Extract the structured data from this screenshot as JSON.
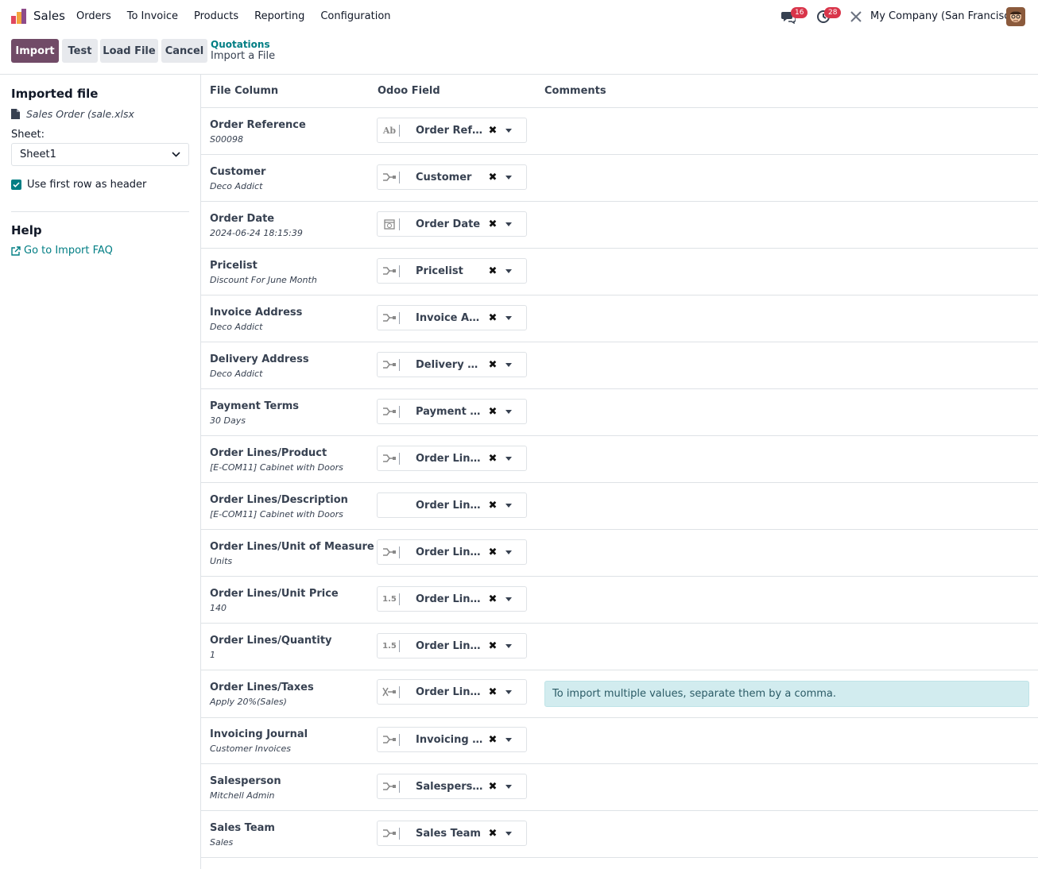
{
  "navbar": {
    "app_name": "Sales",
    "menu": [
      "Orders",
      "To Invoice",
      "Products",
      "Reporting",
      "Configuration"
    ],
    "messages_count": "16",
    "activities_count": "28",
    "company": "My Company (San Francisco)"
  },
  "control_panel": {
    "import_label": "Import",
    "test_label": "Test",
    "load_file_label": "Load File",
    "cancel_label": "Cancel",
    "breadcrumb_parent": "Quotations",
    "breadcrumb_current": "Import a File"
  },
  "sidebar": {
    "imported_file_title": "Imported file",
    "file_name": "Sales Order (sale.xlsx",
    "sheet_label": "Sheet:",
    "sheet_value": "Sheet1",
    "header_checkbox_label": "Use first row as header",
    "header_checkbox_checked": true,
    "help_title": "Help",
    "faq_link": "Go to Import FAQ"
  },
  "table": {
    "headers": {
      "file_column": "File Column",
      "odoo_field": "Odoo Field",
      "comments": "Comments"
    },
    "rows": [
      {
        "column": "Order Reference",
        "sample": "S00098",
        "field": "Order Reference",
        "type_icon": "text-icon",
        "comment": ""
      },
      {
        "column": "Customer",
        "sample": "Deco Addict",
        "field": "Customer",
        "type_icon": "relation-icon",
        "comment": ""
      },
      {
        "column": "Order Date",
        "sample": "2024-06-24 18:15:39",
        "field": "Order Date",
        "type_icon": "datetime-icon",
        "comment": ""
      },
      {
        "column": "Pricelist",
        "sample": "Discount For June Month",
        "field": "Pricelist",
        "type_icon": "relation-icon",
        "comment": ""
      },
      {
        "column": "Invoice Address",
        "sample": "Deco Addict",
        "field": "Invoice Address",
        "type_icon": "relation-icon",
        "comment": ""
      },
      {
        "column": "Delivery Address",
        "sample": "Deco Addict",
        "field": "Delivery Address",
        "type_icon": "relation-icon",
        "comment": ""
      },
      {
        "column": "Payment Terms",
        "sample": "30 Days",
        "field": "Payment Terms",
        "type_icon": "relation-icon",
        "comment": ""
      },
      {
        "column": "Order Lines/Product",
        "sample": "[E-COM11] Cabinet with Doors",
        "field": "Order Lines / Product",
        "type_icon": "relation-icon",
        "comment": ""
      },
      {
        "column": "Order Lines/Description",
        "sample": "[E-COM11] Cabinet with Doors",
        "field": "Order Lines / Description",
        "type_icon": "none",
        "comment": ""
      },
      {
        "column": "Order Lines/Unit of Measure",
        "sample": "Units",
        "field": "Order Lines / Unit of Measure",
        "type_icon": "relation-icon",
        "comment": ""
      },
      {
        "column": "Order Lines/Unit Price",
        "sample": "140",
        "field": "Order Lines / Unit Price",
        "type_icon": "float-icon",
        "comment": ""
      },
      {
        "column": "Order Lines/Quantity",
        "sample": "1",
        "field": "Order Lines / Quantity",
        "type_icon": "float-icon",
        "comment": ""
      },
      {
        "column": "Order Lines/Taxes",
        "sample": "Apply 20%(Sales)",
        "field": "Order Lines / Taxes",
        "type_icon": "many2many-icon",
        "comment": "To import multiple values, separate them by a comma."
      },
      {
        "column": "Invoicing Journal",
        "sample": "Customer Invoices",
        "field": "Invoicing Journal",
        "type_icon": "relation-icon",
        "comment": ""
      },
      {
        "column": "Salesperson",
        "sample": "Mitchell Admin",
        "field": "Salesperson",
        "type_icon": "relation-icon",
        "comment": ""
      },
      {
        "column": "Sales Team",
        "sample": "Sales",
        "field": "Sales Team",
        "type_icon": "relation-icon",
        "comment": ""
      }
    ]
  },
  "colors": {
    "primary": "#714b67",
    "link": "#017e84",
    "badge": "#d9354a",
    "info_bg": "#d2ecef"
  }
}
